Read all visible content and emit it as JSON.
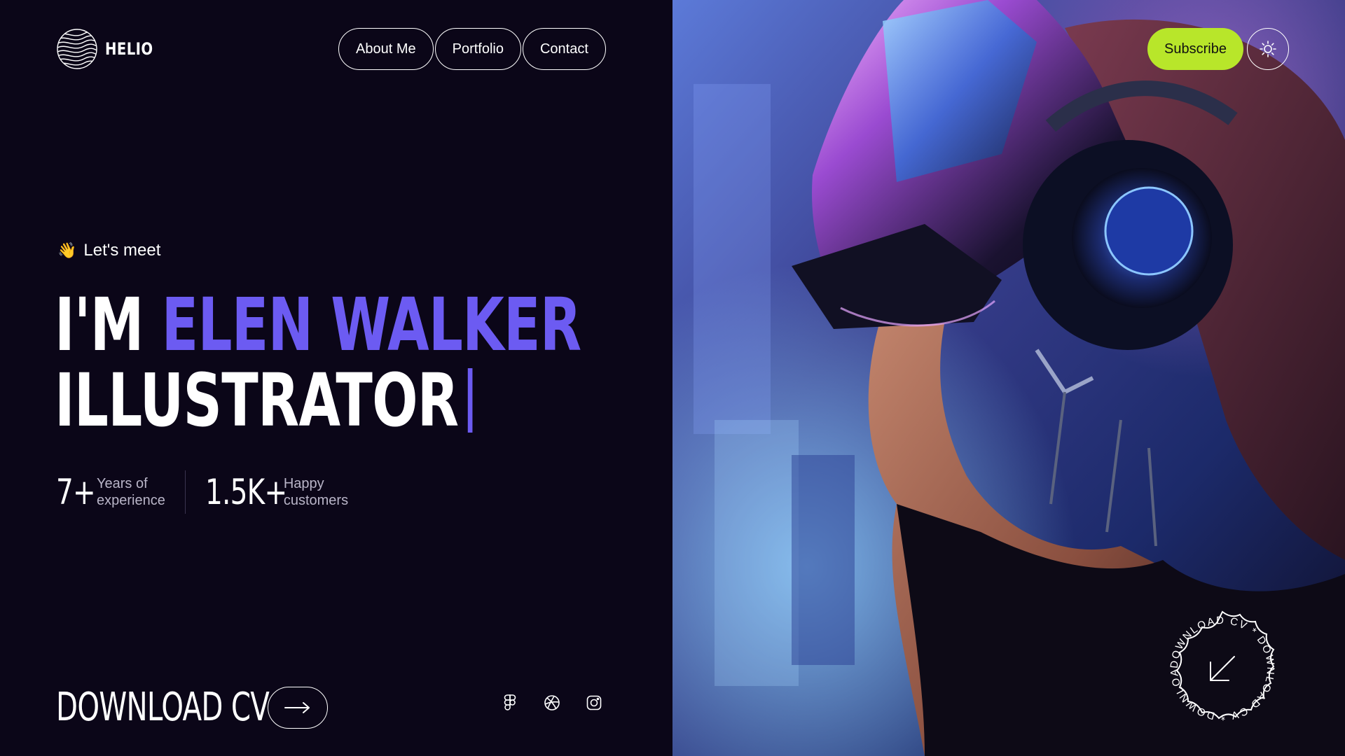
{
  "brand": {
    "name": "HELIO"
  },
  "nav": {
    "items": [
      {
        "label": "About Me"
      },
      {
        "label": "Portfolio"
      },
      {
        "label": "Contact"
      }
    ]
  },
  "header": {
    "subscribe_label": "Subscribe",
    "theme_icon": "sun-icon"
  },
  "hero": {
    "greeting_emoji": "👋",
    "greeting": "Let's meet",
    "headline_prefix": "I'M",
    "headline_name": "ELEN WALKER",
    "headline_role": "ILLUSTRATOR"
  },
  "stats": [
    {
      "value": "7+",
      "label_line1": "Years of",
      "label_line2": "experience"
    },
    {
      "value": "1.5K+",
      "label_line1": "Happy",
      "label_line2": "customers"
    }
  ],
  "download": {
    "label": "DOWNLOAD CV",
    "badge_text": "DOWNLOAD CV * DOWNLOAD CV * DOWNLOAD CV *"
  },
  "socials": [
    {
      "icon": "figma-icon"
    },
    {
      "icon": "dribbble-icon"
    },
    {
      "icon": "instagram-icon"
    }
  ],
  "colors": {
    "background": "#0b0618",
    "accent": "#6c5bf2",
    "subscribe": "#b8e62a",
    "text": "#ffffff"
  }
}
